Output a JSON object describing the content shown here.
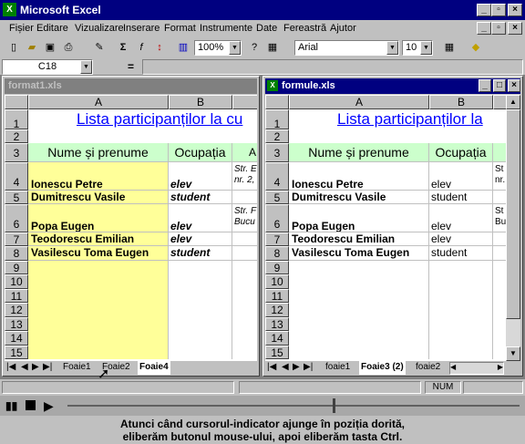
{
  "app": {
    "title": "Microsoft Excel"
  },
  "menu": [
    "Fișier",
    "Editare",
    "Vizualizare",
    "Inserare",
    "Format",
    "Instrumente",
    "Date",
    "Fereastră",
    "Ajutor"
  ],
  "toolbar": {
    "zoom": "100%",
    "font": "Arial",
    "size": "10"
  },
  "formula_bar": {
    "cell_ref": "C18",
    "eq": "="
  },
  "win1": {
    "title": "format1.xls",
    "cols": [
      "A",
      "B"
    ],
    "rows": [
      "1",
      "2",
      "3",
      "4",
      "5",
      "6",
      "7",
      "8",
      "9",
      "10",
      "11",
      "12",
      "13",
      "14",
      "15"
    ],
    "heading": "Lista participanților la cu",
    "header_name": "Nume și prenume",
    "header_occ": "Ocupația",
    "c_partial": "A",
    "data": [
      {
        "name": "Ionescu Petre",
        "occ": "elev",
        "addr1": "Str. E",
        "addr2": "nr. 2,"
      },
      {
        "name": "Dumitrescu Vasile",
        "occ": "student",
        "addr1": "",
        "addr2": ""
      },
      {
        "name": "Popa Eugen",
        "occ": "elev",
        "addr1": "Str. F",
        "addr2": "Bucu"
      },
      {
        "name": "Teodorescu Emilian",
        "occ": "elev",
        "addr1": "",
        "addr2": ""
      },
      {
        "name": "Vasilescu Toma Eugen",
        "occ": "student",
        "addr1": "",
        "addr2": ""
      }
    ],
    "tabs": [
      "Foaie1",
      "Foaie2",
      "Foaie4"
    ]
  },
  "win2": {
    "title": "formule.xls",
    "cols": [
      "A",
      "B"
    ],
    "rows": [
      "1",
      "2",
      "3",
      "4",
      "5",
      "6",
      "7",
      "8",
      "9",
      "10",
      "11",
      "12",
      "13",
      "14",
      "15"
    ],
    "heading": "Lista participanților la",
    "header_name": "Nume și prenume",
    "header_occ": "Ocupația",
    "data": [
      {
        "name": "Ionescu Petre",
        "occ": "elev",
        "addr1": "St",
        "addr2": "nr."
      },
      {
        "name": "Dumitrescu Vasile",
        "occ": "student",
        "addr1": "",
        "addr2": ""
      },
      {
        "name": "Popa Eugen",
        "occ": "elev",
        "addr1": "St",
        "addr2": "Bu"
      },
      {
        "name": "Teodorescu Emilian",
        "occ": "elev",
        "addr1": "",
        "addr2": ""
      },
      {
        "name": "Vasilescu Toma Eugen",
        "occ": "student",
        "addr1": "",
        "addr2": ""
      }
    ],
    "tabs": [
      "foaie1",
      "Foaie3 (2)",
      "foaie2"
    ]
  },
  "status": {
    "num": "NUM"
  },
  "caption": {
    "line1": "Atunci când cursorul-indicator ajunge în poziția dorită,",
    "line2": "eliberăm butonul mouse-ului, apoi eliberăm tasta Ctrl."
  },
  "colors": {
    "title": "#000080",
    "inactive_title": "#808080",
    "heading_link": "#0000ff",
    "yellow": "#ffff99",
    "green": "#ccffcc"
  }
}
